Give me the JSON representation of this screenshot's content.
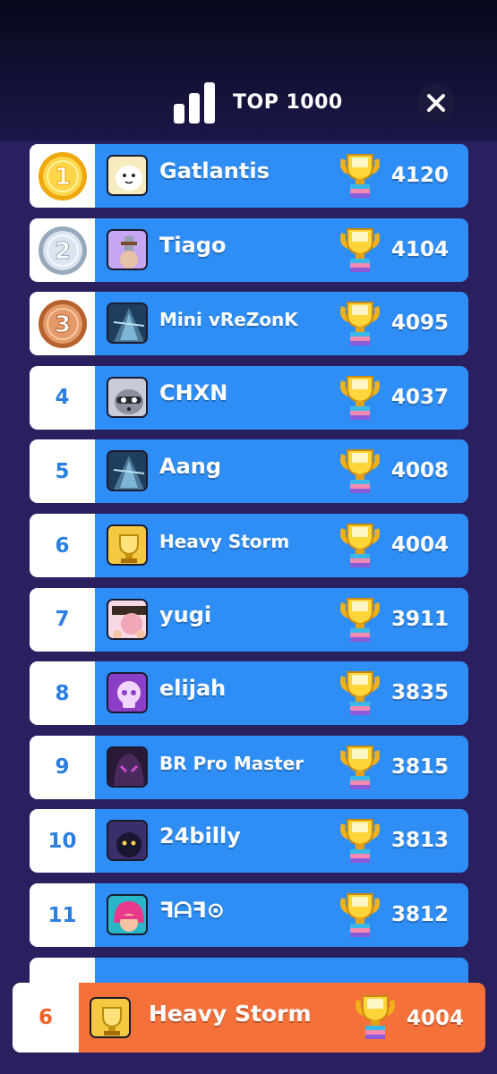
{
  "header": {
    "title": "TOP 1000",
    "leaderboard_icon": "bar-chart-icon",
    "close_icon": "close-icon"
  },
  "colors": {
    "row_blue": "#2f8ef6",
    "rank_text": "#2c7fe0",
    "highlight_orange": "#f5713a",
    "gold": "#f7c21a",
    "silver": "#b9c6d8",
    "bronze": "#d2804a"
  },
  "entries": [
    {
      "rank": "1",
      "medal": "gold",
      "name": "Gatlantis",
      "score": "4120",
      "avatar": "ghost-avatar"
    },
    {
      "rank": "2",
      "medal": "silver",
      "name": "Tiago",
      "score": "4104",
      "avatar": "knight-avatar"
    },
    {
      "rank": "3",
      "medal": "bronze",
      "name": "Mini vReZonK",
      "score": "4095",
      "avatar": "tower-avatar"
    },
    {
      "rank": "4",
      "name": "CHXN",
      "score": "4037",
      "avatar": "raccoon-avatar"
    },
    {
      "rank": "5",
      "name": "Aang",
      "score": "4008",
      "avatar": "tower-avatar"
    },
    {
      "rank": "6",
      "name": "Heavy Storm",
      "score": "4004",
      "avatar": "trophy-avatar"
    },
    {
      "rank": "7",
      "name": "yugi",
      "score": "3911",
      "avatar": "brawler-avatar"
    },
    {
      "rank": "8",
      "name": "elijah",
      "score": "3835",
      "avatar": "skull-avatar"
    },
    {
      "rank": "9",
      "name": "BR Pro Master",
      "score": "3815",
      "avatar": "hood-avatar"
    },
    {
      "rank": "10",
      "name": "24billy",
      "score": "3813",
      "avatar": "shadow-avatar"
    },
    {
      "rank": "11",
      "name": "ꟻᗩꟻ⊙",
      "score": "3812",
      "avatar": "pink-hair-avatar"
    }
  ],
  "current_player": {
    "rank": "6",
    "name": "Heavy Storm",
    "score": "4004",
    "avatar": "trophy-avatar"
  }
}
